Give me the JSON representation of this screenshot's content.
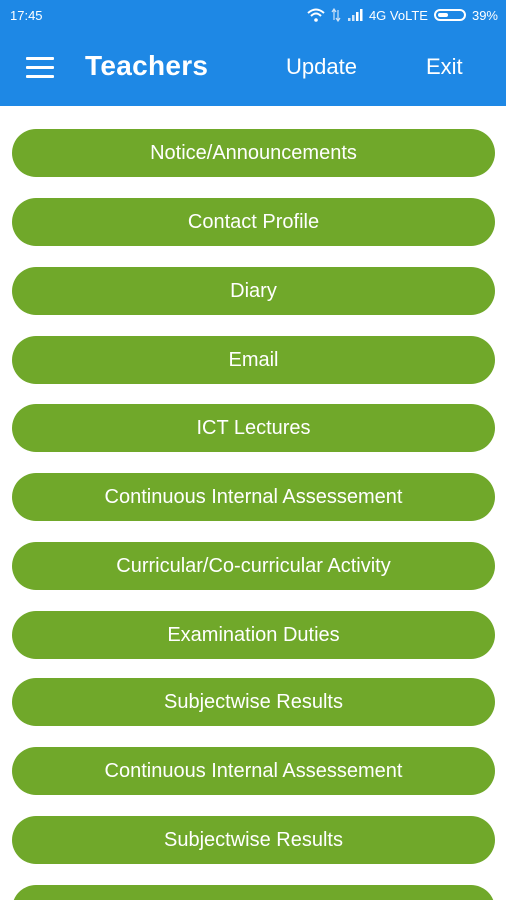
{
  "status_bar": {
    "time": "17:45",
    "network": "4G VoLTE",
    "battery": "39%"
  },
  "app_bar": {
    "title": "Teachers",
    "update_label": "Update",
    "exit_label": "Exit"
  },
  "menu": {
    "items": [
      {
        "label": "Notice/Announcements"
      },
      {
        "label": "Contact Profile"
      },
      {
        "label": "Diary"
      },
      {
        "label": "Email"
      },
      {
        "label": "ICT Lectures"
      },
      {
        "label": "Continuous Internal Assessement"
      },
      {
        "label": "Curricular/Co-curricular Activity"
      },
      {
        "label": "Examination Duties"
      },
      {
        "label": "Subjectwise Results"
      },
      {
        "label": "Continuous Internal Assessement"
      },
      {
        "label": "Subjectwise Results"
      },
      {
        "label": ""
      }
    ]
  },
  "colors": {
    "primary": "#1e88e5",
    "button": "#70a82a"
  }
}
